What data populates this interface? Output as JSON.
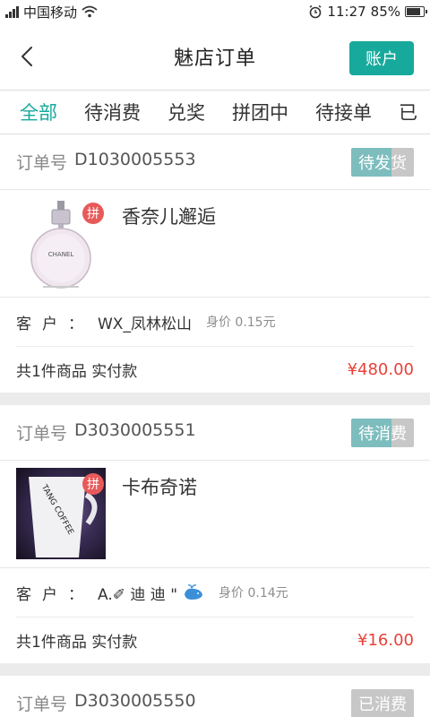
{
  "status_bar": {
    "carrier": "中国移动",
    "time": "11:27",
    "battery": "85%",
    "battery_level": 0.85
  },
  "header": {
    "title": "魅店订单",
    "account_label": "账户"
  },
  "tabs": [
    {
      "label": "全部",
      "active": true
    },
    {
      "label": "待消费",
      "active": false
    },
    {
      "label": "兑奖",
      "active": false
    },
    {
      "label": "拼团中",
      "active": false
    },
    {
      "label": "待接单",
      "active": false
    },
    {
      "label": "已",
      "active": false
    }
  ],
  "orders": [
    {
      "order_label": "订单号",
      "order_no": "D1030005553",
      "status": "待发货",
      "pin_label": "拼",
      "product_name": "香奈儿邂逅",
      "thumb_text": "CHANEL",
      "customer_label": "客户：",
      "customer_name": "WX_凤林松山",
      "price_label": "身价 0.15元",
      "summary": "共1件商品 实付款",
      "amount": "¥480.00"
    },
    {
      "order_label": "订单号",
      "order_no": "D3030005551",
      "status": "待消费",
      "pin_label": "拼",
      "product_name": "卡布奇诺",
      "thumb_text": "TANG COFFEE",
      "customer_label": "客户：",
      "customer_name": "A.✐ 迪 迪 \"",
      "price_label": "身价 0.14元",
      "summary": "共1件商品 实付款",
      "amount": "¥16.00"
    },
    {
      "order_label": "订单号",
      "order_no": "D3030005550",
      "status": "已消费"
    }
  ],
  "colors": {
    "accent": "#17a99c",
    "price": "#e8413a",
    "badge_teal": "#7dbdbe",
    "badge_grey": "#c7c7c7"
  }
}
